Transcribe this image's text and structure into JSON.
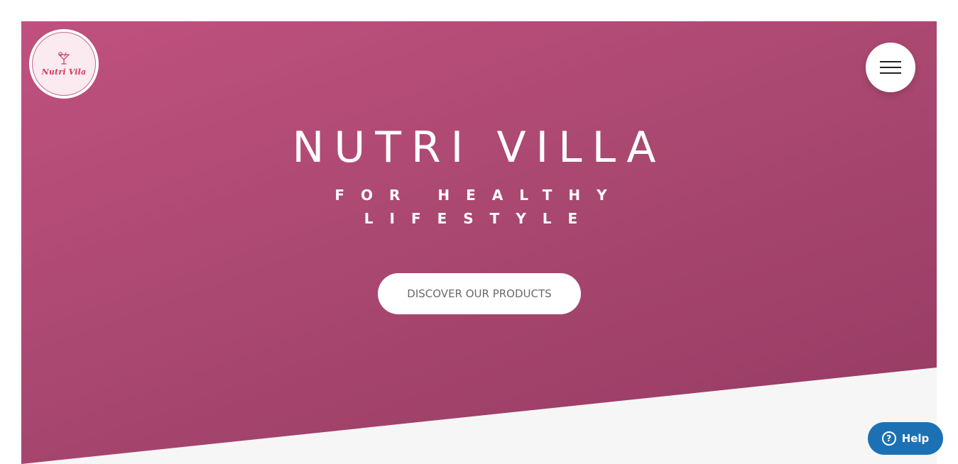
{
  "brand": {
    "logo_text": "Nutri Vila",
    "logo_icon": "cocktail-glass-icon",
    "accent_color": "#d23a63"
  },
  "hero": {
    "title": "NUTRI VILLA",
    "subtitle": "FOR HEALTHY LIFESTYLE",
    "cta_label": "DISCOVER OUR PRODUCTS",
    "gradient_colors": [
      "#c0517f",
      "#953a63"
    ]
  },
  "nav": {
    "menu_icon": "hamburger-menu-icon"
  },
  "help_widget": {
    "label": "Help",
    "icon": "question-circle-icon",
    "icon_glyph": "?",
    "color": "#1c71b5"
  }
}
